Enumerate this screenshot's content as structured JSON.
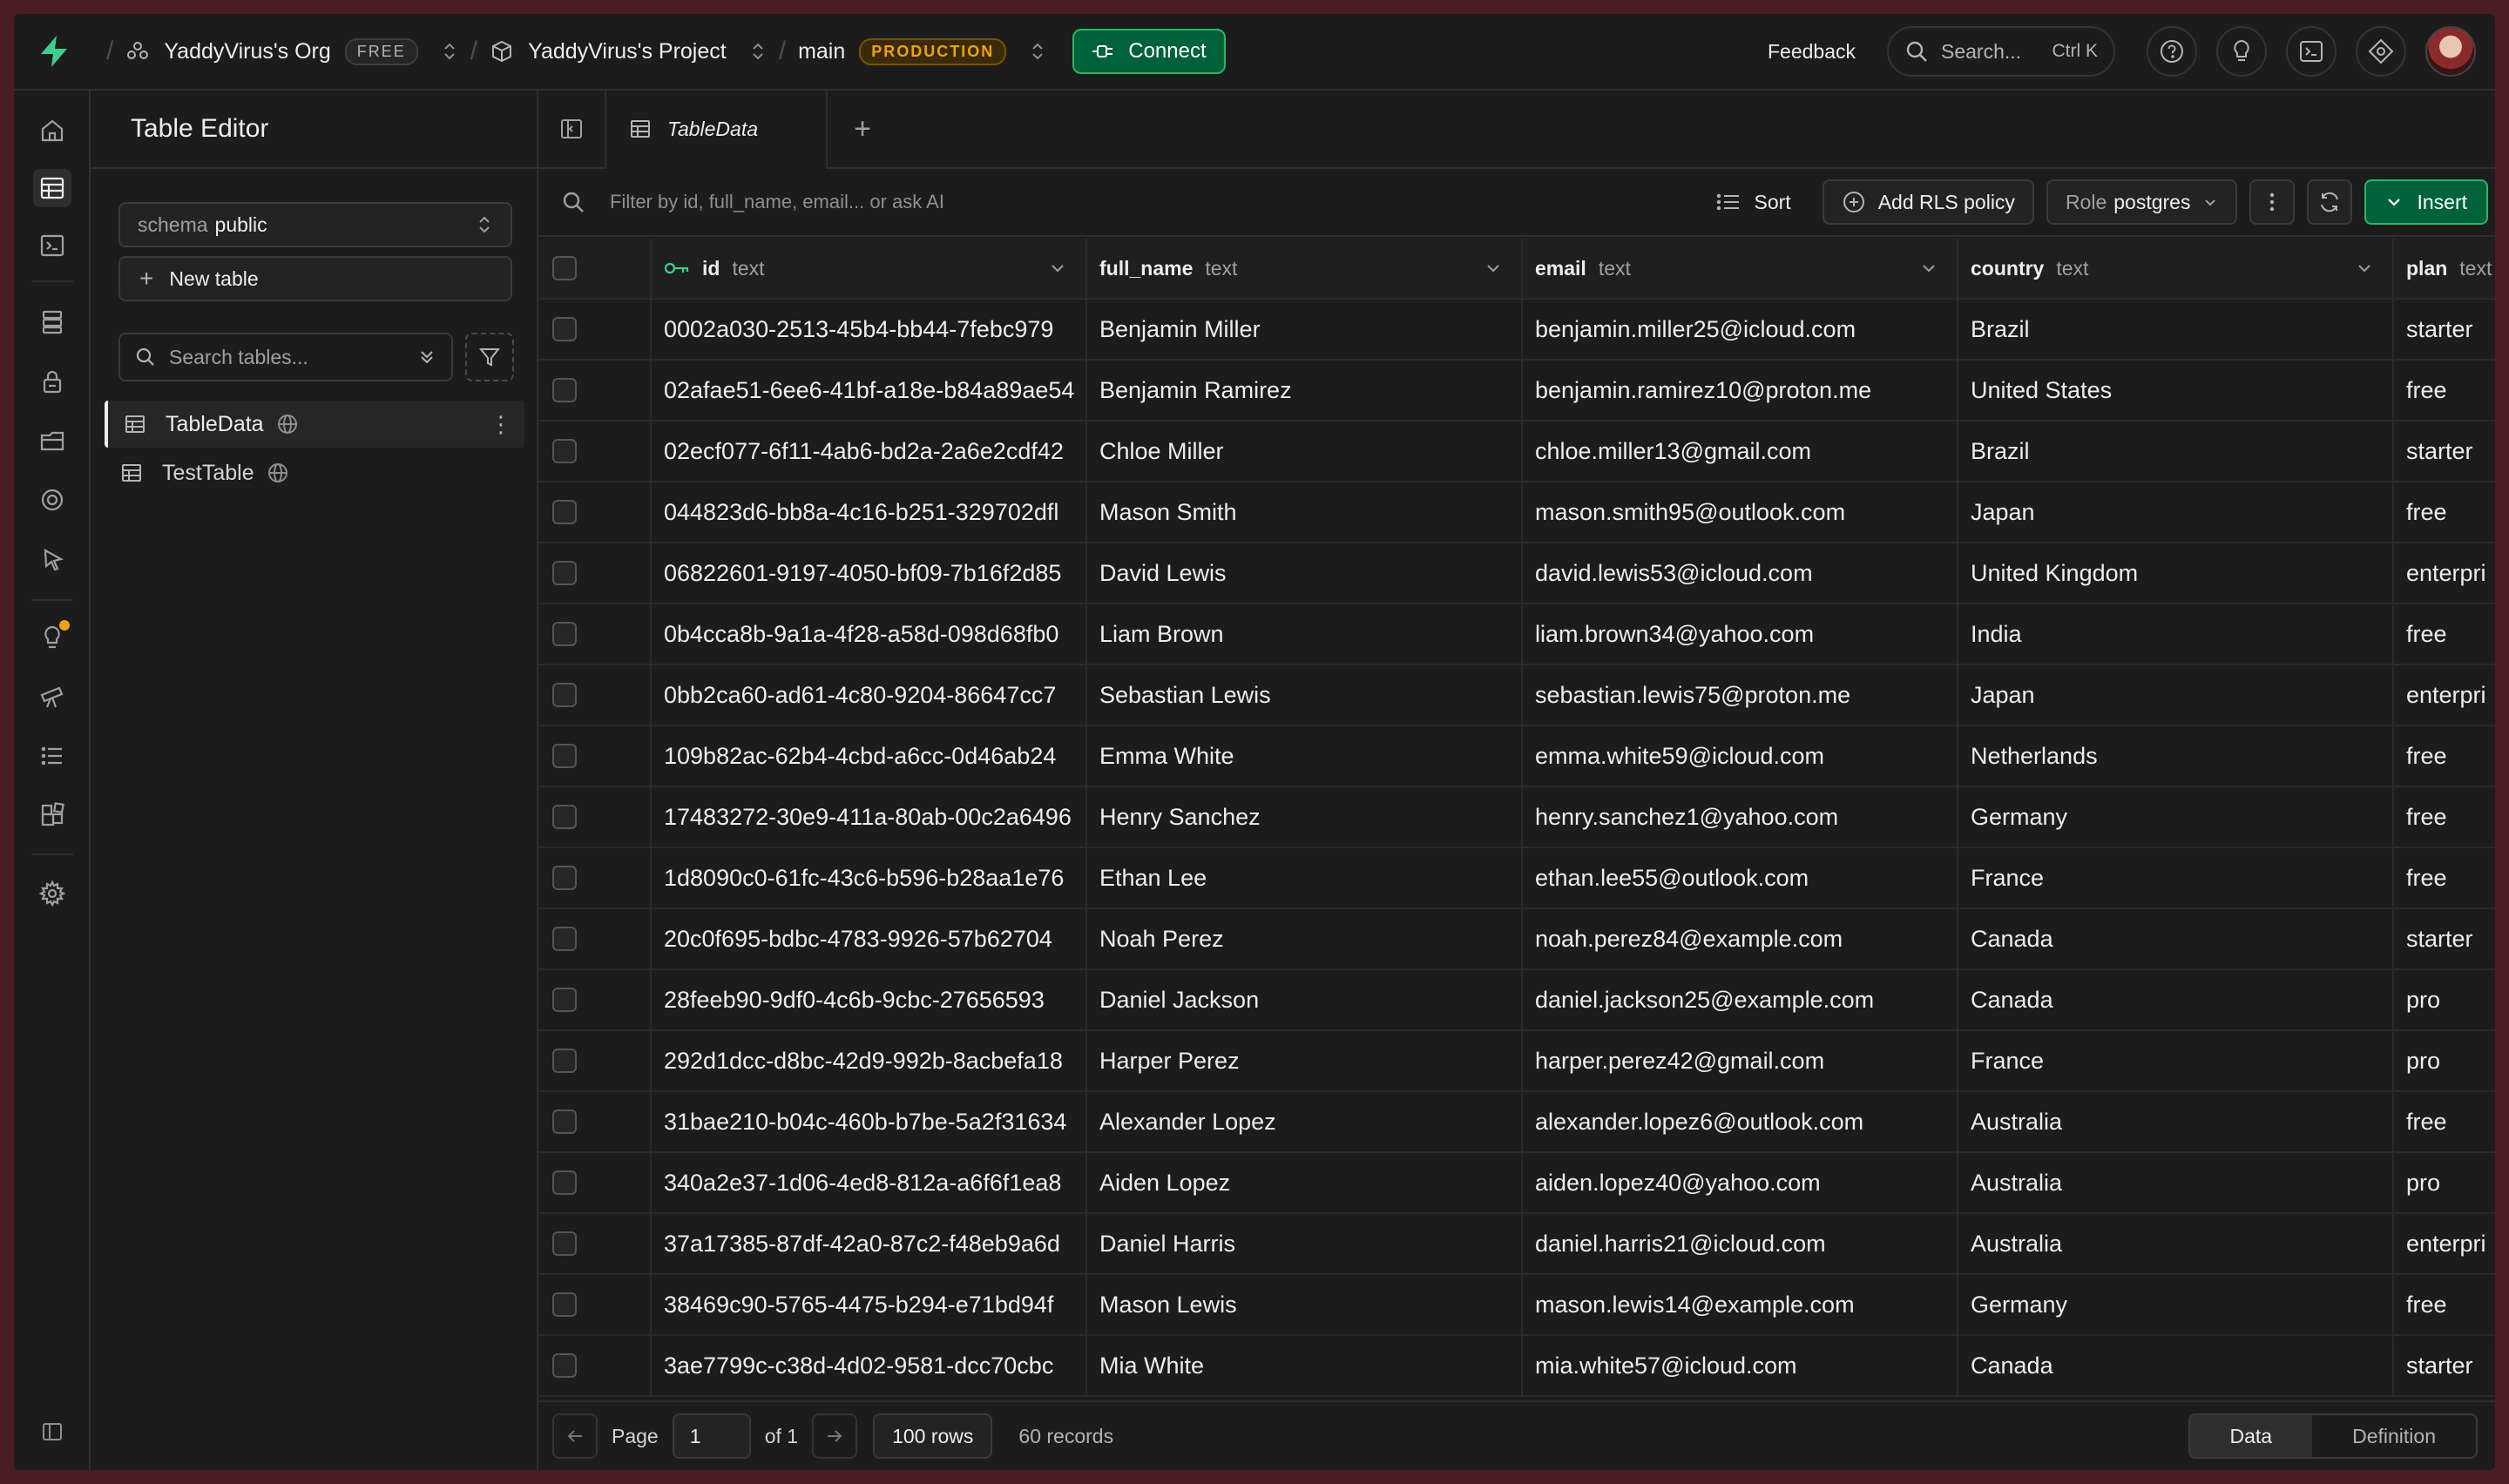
{
  "topbar": {
    "org": "YaddyVirus's Org",
    "org_badge": "FREE",
    "project": "YaddyVirus's Project",
    "branch": "main",
    "branch_badge": "PRODUCTION",
    "connect_label": "Connect",
    "feedback_label": "Feedback",
    "search_placeholder": "Search...",
    "search_shortcut": "Ctrl K"
  },
  "sidebar": {
    "title": "Table Editor",
    "schema_label": "schema",
    "schema_value": "public",
    "new_table_label": "New table",
    "search_placeholder": "Search tables...",
    "tables": [
      {
        "name": "TableData",
        "active": true
      },
      {
        "name": "TestTable",
        "active": false
      }
    ]
  },
  "tabs": {
    "active_tab": "TableData"
  },
  "toolbar": {
    "filter_placeholder": "Filter by id, full_name, email... or ask AI",
    "sort_label": "Sort",
    "rls_label": "Add RLS policy",
    "role_label": "Role",
    "role_value": "postgres",
    "insert_label": "Insert"
  },
  "grid": {
    "columns": [
      {
        "name": "id",
        "type": "text"
      },
      {
        "name": "full_name",
        "type": "text"
      },
      {
        "name": "email",
        "type": "text"
      },
      {
        "name": "country",
        "type": "text"
      },
      {
        "name": "plan",
        "type": "text"
      }
    ],
    "rows": [
      [
        "0002a030-2513-45b4-bb44-7febc979",
        "Benjamin Miller",
        "benjamin.miller25@icloud.com",
        "Brazil",
        "starter"
      ],
      [
        "02afae51-6ee6-41bf-a18e-b84a89ae54",
        "Benjamin Ramirez",
        "benjamin.ramirez10@proton.me",
        "United States",
        "free"
      ],
      [
        "02ecf077-6f11-4ab6-bd2a-2a6e2cdf42",
        "Chloe Miller",
        "chloe.miller13@gmail.com",
        "Brazil",
        "starter"
      ],
      [
        "044823d6-bb8a-4c16-b251-329702dfl",
        "Mason Smith",
        "mason.smith95@outlook.com",
        "Japan",
        "free"
      ],
      [
        "06822601-9197-4050-bf09-7b16f2d85",
        "David Lewis",
        "david.lewis53@icloud.com",
        "United Kingdom",
        "enterpri"
      ],
      [
        "0b4cca8b-9a1a-4f28-a58d-098d68fb0",
        "Liam Brown",
        "liam.brown34@yahoo.com",
        "India",
        "free"
      ],
      [
        "0bb2ca60-ad61-4c80-9204-86647cc7",
        "Sebastian Lewis",
        "sebastian.lewis75@proton.me",
        "Japan",
        "enterpri"
      ],
      [
        "109b82ac-62b4-4cbd-a6cc-0d46ab24",
        "Emma White",
        "emma.white59@icloud.com",
        "Netherlands",
        "free"
      ],
      [
        "17483272-30e9-411a-80ab-00c2a6496",
        "Henry Sanchez",
        "henry.sanchez1@yahoo.com",
        "Germany",
        "free"
      ],
      [
        "1d8090c0-61fc-43c6-b596-b28aa1e76",
        "Ethan Lee",
        "ethan.lee55@outlook.com",
        "France",
        "free"
      ],
      [
        "20c0f695-bdbc-4783-9926-57b62704",
        "Noah Perez",
        "noah.perez84@example.com",
        "Canada",
        "starter"
      ],
      [
        "28feeb90-9df0-4c6b-9cbc-27656593",
        "Daniel Jackson",
        "daniel.jackson25@example.com",
        "Canada",
        "pro"
      ],
      [
        "292d1dcc-d8bc-42d9-992b-8acbefa18",
        "Harper Perez",
        "harper.perez42@gmail.com",
        "France",
        "pro"
      ],
      [
        "31bae210-b04c-460b-b7be-5a2f31634",
        "Alexander Lopez",
        "alexander.lopez6@outlook.com",
        "Australia",
        "free"
      ],
      [
        "340a2e37-1d06-4ed8-812a-a6f6f1ea8",
        "Aiden Lopez",
        "aiden.lopez40@yahoo.com",
        "Australia",
        "pro"
      ],
      [
        "37a17385-87df-42a0-87c2-f48eb9a6d",
        "Daniel Harris",
        "daniel.harris21@icloud.com",
        "Australia",
        "enterpri"
      ],
      [
        "38469c90-5765-4475-b294-e71bd94f",
        "Mason Lewis",
        "mason.lewis14@example.com",
        "Germany",
        "free"
      ],
      [
        "3ae7799c-c38d-4d02-9581-dcc70cbc",
        "Mia White",
        "mia.white57@icloud.com",
        "Canada",
        "starter"
      ]
    ]
  },
  "footer": {
    "page_label": "Page",
    "page_value": "1",
    "of_label": "of 1",
    "rows_label": "100 rows",
    "records_label": "60 records",
    "view_data": "Data",
    "view_definition": "Definition"
  },
  "colors": {
    "accent_green": "#3ecf8e",
    "button_green": "#006239",
    "badge_orange": "#f1a10d"
  }
}
